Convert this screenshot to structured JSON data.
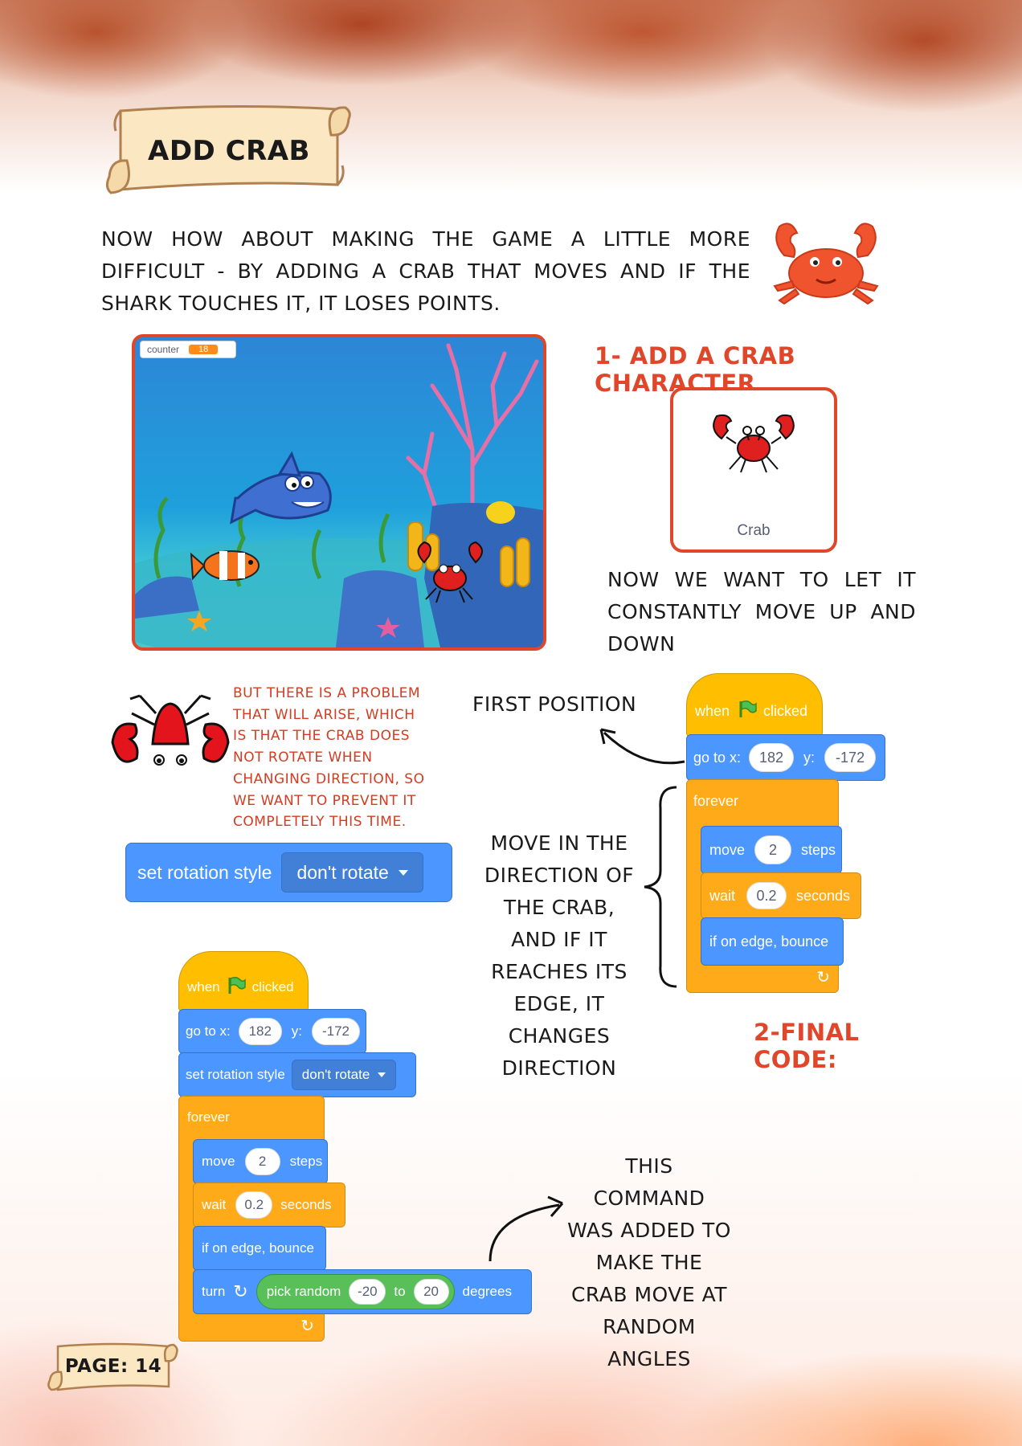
{
  "title_banner": "ADD CRAB",
  "intro_text": "NOW HOW ABOUT MAKING THE GAME A LITTLE MORE DIFFICULT - BY ADDING A CRAB THAT MOVES AND IF THE SHARK TOUCHES IT, IT LOSES POINTS.",
  "stage": {
    "counter_label": "counter",
    "counter_value": "18"
  },
  "step1_heading": "1- ADD A CRAB CHARACTER",
  "sprite_card": {
    "name": "Crab"
  },
  "move_text": "NOW WE WANT TO LET IT CONSTANTLY MOVE UP AND DOWN",
  "problem_text": "BUT THERE IS A PROBLEM THAT WILL ARISE, WHICH IS THAT THE CRAB DOES NOT ROTATE WHEN CHANGING DIRECTION, SO WE WANT TO PREVENT IT COMPLETELY THIS TIME.",
  "rotation_block": {
    "label": "set rotation style",
    "option": "don't rotate"
  },
  "first_position_label": "FIRST POSITION",
  "direction_text": "MOVE IN THE DIRECTION OF THE CRAB, AND IF IT REACHES ITS EDGE, IT CHANGES DIRECTION",
  "step2_heading": "2-FINAL CODE:",
  "added_text": "THIS COMMAND WAS ADDED TO MAKE THE CRAB MOVE AT RANDOM ANGLES",
  "page_label": "PAGE: 14",
  "blocks": {
    "when": "when",
    "clicked": "clicked",
    "go_to_x": "go to x:",
    "x_value": "182",
    "y_label": "y:",
    "y_value": "-172",
    "forever": "forever",
    "move": "move",
    "steps_value": "2",
    "steps": "steps",
    "wait": "wait",
    "wait_value": "0.2",
    "seconds": "seconds",
    "bounce": "if on edge, bounce",
    "set_rotation": "set rotation style",
    "rotation_option": "don't rotate",
    "turn": "turn",
    "pick_random": "pick random",
    "random_from": "-20",
    "to": "to",
    "random_to": "20",
    "degrees": "degrees"
  },
  "colors": {
    "accent_red": "#e0462a",
    "motion_blue": "#4c97ff",
    "control_orange": "#ffab19",
    "event_yellow": "#ffbf00",
    "operator_green": "#59c059"
  }
}
